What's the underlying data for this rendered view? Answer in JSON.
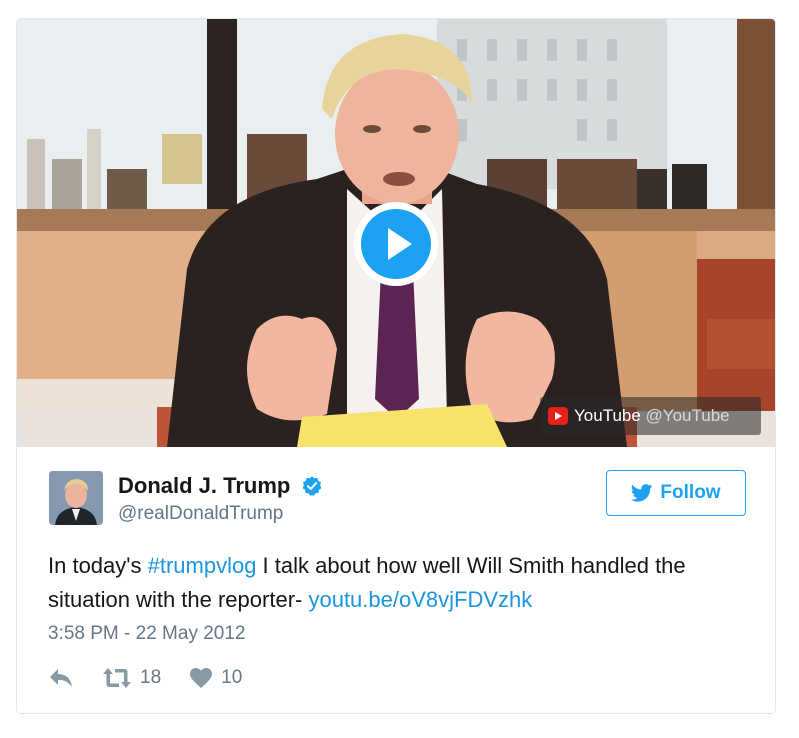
{
  "media": {
    "provider_label": "YouTube",
    "provider_handle": "@YouTube",
    "play_icon": "play-icon"
  },
  "author": {
    "display_name": "Donald J. Trump",
    "screen_name": "@realDonaldTrump",
    "verified": true
  },
  "follow_button": {
    "label": "Follow",
    "icon": "twitter-bird-icon"
  },
  "tweet": {
    "text_prefix": "In today's ",
    "hashtag": "#trumpvlog",
    "text_middle": " I talk about how well Will Smith handled the situation with the reporter- ",
    "link": "youtu.be/oV8vjFDVzhk",
    "timestamp": "3:58 PM - 22 May 2012"
  },
  "actions": {
    "reply_icon": "reply-icon",
    "retweet_icon": "retweet-icon",
    "retweet_count": "18",
    "like_icon": "heart-icon",
    "like_count": "10"
  },
  "colors": {
    "accent": "#1da1f2",
    "link": "#1b95e0",
    "secondary_text": "#657786",
    "youtube_red": "#e62117"
  }
}
